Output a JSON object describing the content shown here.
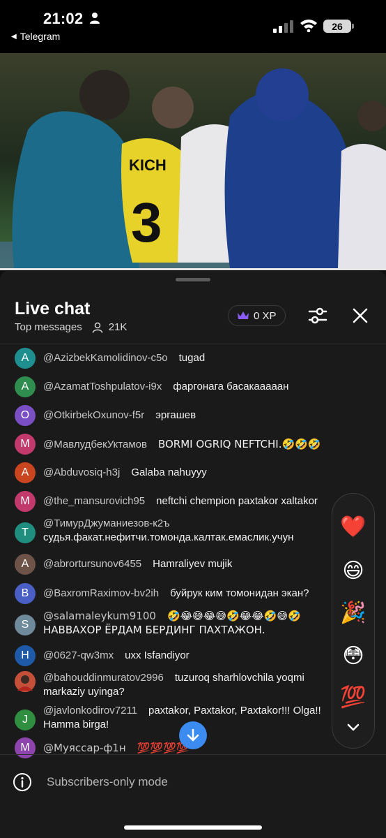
{
  "status_bar": {
    "time": "21:02",
    "back_label": "Telegram",
    "battery": "26"
  },
  "chat": {
    "title": "Live chat",
    "mode": "Top messages",
    "viewers": "21K",
    "xp": "0 XP"
  },
  "messages": [
    {
      "avatar_letter": "A",
      "avatar_color": "#1f8e8e",
      "author": "@AzizbekKamolidinov-c5o",
      "text": "tugad"
    },
    {
      "avatar_letter": "A",
      "avatar_color": "#2f8e4f",
      "author": "@AzamatToshpulatov-i9x",
      "text": "фаргонага басакааааан"
    },
    {
      "avatar_letter": "O",
      "avatar_color": "#7b4fc4",
      "author": "@OtkirbekOxunov-f5r",
      "text": "эргашев"
    },
    {
      "avatar_letter": "M",
      "avatar_color": "#c23a6c",
      "author": "@МавлудбекУктамов",
      "text": "BORMI OGRIQ NEFTCHI.🤣🤣🤣"
    },
    {
      "avatar_letter": "A",
      "avatar_color": "#c8451f",
      "author": "@Abduvosiq-h3j",
      "text": "Galaba nahuyyy"
    },
    {
      "avatar_letter": "M",
      "avatar_color": "#c23a6c",
      "author": "@the_mansurovich95",
      "text": "neftchi chempion paxtakor xaltakor"
    },
    {
      "avatar_letter": "T",
      "avatar_color": "#1f8e7e",
      "author": "@ТимурДжуманиезов-к2ъ",
      "text": "судья.факат.нефитчи.томонда.калтак.емаслик.учун"
    },
    {
      "avatar_letter": "A",
      "avatar_color": "#6d5348",
      "author": "@abrortursunov6455",
      "text": "Hamraliyev mujik"
    },
    {
      "avatar_letter": "B",
      "avatar_color": "#4a5fc4",
      "author": "@BaxromRaximov-bv2ih",
      "text": "буйрук ким томонидан экан?"
    },
    {
      "avatar_letter": "S",
      "avatar_color": "#6f8a9a",
      "author": "@salamaleykum9100",
      "text": "🤣😂😅😂😅🤣😂😂🤣😅🤣 НАВВАХОР ЁРДАМ БЕРДИНГ ПАХТАЖОН."
    },
    {
      "avatar_letter": "H",
      "avatar_color": "#1e5aa8",
      "author": "@0627-qw3mx",
      "text": "uxx Isfandiyor"
    },
    {
      "avatar_letter": "",
      "avatar_color": "#8a3a2a",
      "author": "@bahouddinmuratov2996",
      "text": "tuzuroq sharhlovchila yoqmi markaziy uyinga?"
    },
    {
      "avatar_letter": "J",
      "avatar_color": "#2f8e3f",
      "author": "@javlonkodirov7211",
      "text": "paxtakor, Paxtakor, Paxtakor!!! Olga!! Hamma birga!"
    },
    {
      "avatar_letter": "M",
      "avatar_color": "#8e44ad",
      "author": "@Муяссар-ф1н",
      "text": "💯💯💯💯"
    }
  ],
  "reactions": [
    {
      "emoji": "❤️",
      "name": "heart-icon"
    },
    {
      "emoji": "😄",
      "name": "grin-icon"
    },
    {
      "emoji": "🎉",
      "name": "party-popper-icon"
    },
    {
      "emoji": "😳",
      "name": "flushed-face-icon"
    },
    {
      "emoji": "💯",
      "name": "hundred-points-icon"
    }
  ],
  "composer": {
    "status": "Subscribers-only mode"
  },
  "colors": {
    "accent_blue": "#3b8bf0",
    "crown_purple": "#8a5cf5",
    "sheet_bg": "#1a1a1a"
  }
}
